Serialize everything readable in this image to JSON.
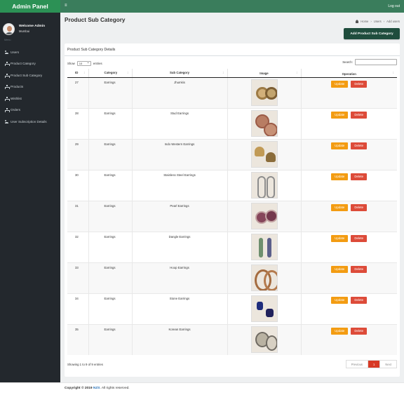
{
  "app": {
    "title": "Admin Panel",
    "logout": "Log out",
    "menu_icon": "≡"
  },
  "sidebar": {
    "user_name": "Welcome Admin",
    "user_location": "Mumbai",
    "menu_label": "Menu",
    "items": [
      {
        "label": "Users",
        "icon": "users-icon"
      },
      {
        "label": "Product Category",
        "icon": "sitemap-icon"
      },
      {
        "label": "Product Sub Category",
        "icon": "sitemap-icon"
      },
      {
        "label": "Products",
        "icon": "sitemap-icon"
      },
      {
        "label": "Wishlist",
        "icon": "sitemap-icon"
      },
      {
        "label": "Orders",
        "icon": "sitemap-icon"
      },
      {
        "label": "User Subscription Details",
        "icon": "users-icon"
      }
    ]
  },
  "header": {
    "page_title": "Product Sub Category",
    "breadcrumb": [
      "Home",
      "Users",
      "Add users"
    ],
    "add_button": "Add Product Sub Category"
  },
  "table_card": {
    "title": "Product Sub Category Details",
    "show_label": "Show",
    "entries_label": "entries",
    "page_size": "10",
    "search_label": "Search:",
    "headers": [
      "ID",
      "Category",
      "Sub Category",
      "Image",
      "Operation"
    ],
    "rows": [
      {
        "id": "27",
        "category": "Earrings",
        "sub_category": "Jhumkis",
        "image_icon": "jhumkis-image"
      },
      {
        "id": "28",
        "category": "Earrings",
        "sub_category": "Stud Earrings",
        "image_icon": "stud-earrings-image"
      },
      {
        "id": "29",
        "category": "Earrings",
        "sub_category": "Indo Western Earrings",
        "image_icon": "indo-western-earrings-image"
      },
      {
        "id": "30",
        "category": "Earrings",
        "sub_category": "Stainless Steel Earrings",
        "image_icon": "stainless-steel-earrings-image"
      },
      {
        "id": "31",
        "category": "Earrings",
        "sub_category": "Pearl Earrings",
        "image_icon": "pearl-earrings-image"
      },
      {
        "id": "32",
        "category": "Earrings",
        "sub_category": "Dangle Earrings",
        "image_icon": "dangle-earrings-image"
      },
      {
        "id": "33",
        "category": "Earrings",
        "sub_category": "Hoop Earrings",
        "image_icon": "hoop-earrings-image"
      },
      {
        "id": "34",
        "category": "Earrings",
        "sub_category": "Stone Earrings",
        "image_icon": "stone-earrings-image"
      },
      {
        "id": "35",
        "category": "Earrings",
        "sub_category": "Korean Earrings",
        "image_icon": "korean-earrings-image"
      }
    ],
    "update_label": "Update",
    "delete_label": "Delete",
    "info": "Showing 1 to 9 of 9 entries",
    "pagination": {
      "previous": "Previous",
      "page": "1",
      "next": "Next"
    }
  },
  "footer": {
    "prefix": "Copyright © 2019",
    "brand": "NZS",
    "suffix": ". All rights reserved."
  },
  "colors": {
    "sidebar_bg": "#23282d",
    "topbar": "#3a7d5c",
    "brand": "#2c9155",
    "update": "#f39c12",
    "delete": "#dd4b39",
    "primary_button": "#1f4d3d"
  }
}
